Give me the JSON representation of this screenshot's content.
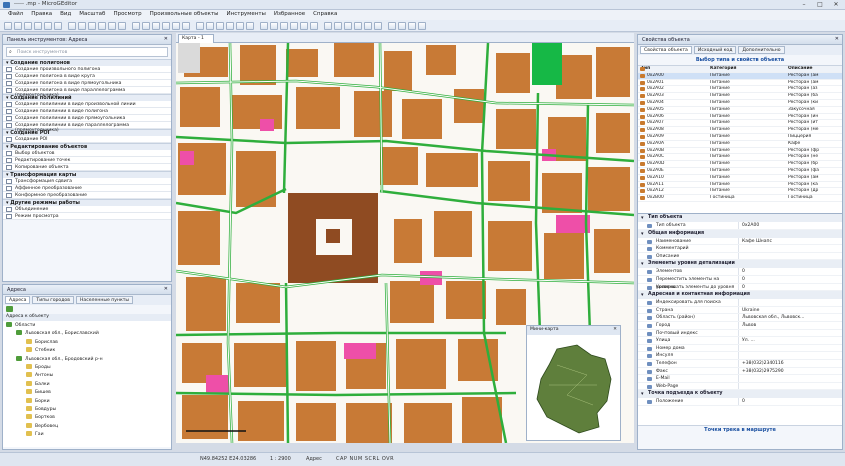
{
  "window": {
    "title": "----- .mp - MicroGEditor"
  },
  "menu": [
    "Файл",
    "Правка",
    "Вид",
    "Масштаб",
    "Просмотр",
    "Произвольные объекты",
    "Инструменты",
    "Избранное",
    "Справка"
  ],
  "tools_panel": {
    "title": "Панель инструментов: Адреса",
    "search_placeholder": "Поиск инструментов",
    "groups": [
      {
        "label": "Создание полигонов",
        "items": [
          "Создание произвольного полигона",
          "Создание полигона в виде круга",
          "Создание полигона в виде прямоугольника",
          "Создание полигона в виде параллелограмма (прямоугольника)"
        ]
      },
      {
        "label": "Создание полилиний",
        "items": [
          "Создание полилинии в виде произвольной линии",
          "Создание полилинии в виде полигона",
          "Создание полилинии в виде прямоугольника",
          "Создание полилинии в виде параллелограмма (прямоугольника)"
        ]
      },
      {
        "label": "Создание POI",
        "items": [
          "Создание POI"
        ]
      },
      {
        "label": "Редактирование объектов",
        "items": [
          "Выбор объектов",
          "Редактирование точек",
          "Копирование объекта"
        ]
      },
      {
        "label": "Трансформация карты",
        "items": [
          "Трансформация сдвига",
          "Аффинное преобразование",
          "Конформное преобразование"
        ]
      },
      {
        "label": "Другие режимы работы",
        "items": [
          "Объединение",
          "Режим просмотра"
        ]
      }
    ]
  },
  "addr_panel": {
    "title": "Адреса",
    "tabs": [
      "Адреса",
      "Типы городов",
      "Населенные пункты"
    ],
    "subheader": "Адреса к объекту",
    "tree": [
      {
        "label": "Области",
        "level": 0
      },
      {
        "label": "Львовская обл., Бориславский",
        "level": 1
      },
      {
        "label": "Борислав",
        "level": 2
      },
      {
        "label": "Стебник",
        "level": 2
      },
      {
        "label": "Львовская обл., Бродовский р-н",
        "level": 1
      },
      {
        "label": "Броды",
        "level": 2
      },
      {
        "label": "Антоны",
        "level": 2
      },
      {
        "label": "Балки",
        "level": 2
      },
      {
        "label": "Бишев",
        "level": 2
      },
      {
        "label": "Борки",
        "level": 2
      },
      {
        "label": "Бовдуры",
        "level": 2
      },
      {
        "label": "Бортков",
        "level": 2
      },
      {
        "label": "Вербовец",
        "level": 2
      },
      {
        "label": "Гаи",
        "level": 2
      }
    ]
  },
  "map": {
    "tab_label": "Карта - 1",
    "minimap_title": "Мини-карта"
  },
  "props_panel": {
    "title": "Свойства объекта",
    "tabs": [
      "Свойства объекта",
      "Исходный код",
      "Дополнительно"
    ],
    "type_header": "Выбор типа и свойств объекта",
    "columns": [
      "Тип",
      "Категория",
      "Описание"
    ],
    "rows": [
      [
        "0x2A00",
        "Питание",
        "Ресторан (ам"
      ],
      [
        "0x2A01",
        "Питание",
        "Ресторан (ам"
      ],
      [
        "0x2A02",
        "Питание",
        "Ресторан (аз"
      ],
      [
        "0x2A03",
        "Питание",
        "Ресторан (ба"
      ],
      [
        "0x2A04",
        "Питание",
        "Ресторан (ки"
      ],
      [
        "0x2A05",
        "Питание",
        "Закусочная"
      ],
      [
        "0x2A06",
        "Питание",
        "Ресторан (ин"
      ],
      [
        "0x2A07",
        "Питание",
        "Ресторан (ит"
      ],
      [
        "0x2A08",
        "Питание",
        "Ресторан (ме"
      ],
      [
        "0x2A09",
        "Питание",
        "Пиццерия"
      ],
      [
        "0x2A0A",
        "Питание",
        "Кафе"
      ],
      [
        "0x2A0B",
        "Питание",
        "Ресторан (фр"
      ],
      [
        "0x2A0C",
        "Питание",
        "Ресторан (не"
      ],
      [
        "0x2A0D",
        "Питание",
        "Ресторан (бр"
      ],
      [
        "0x2A0E",
        "Питание",
        "Ресторан (фа"
      ],
      [
        "0x2A10",
        "Питание",
        "Ресторан (ам"
      ],
      [
        "0x2A11",
        "Питание",
        "Ресторан (ка"
      ],
      [
        "0x2A12",
        "Питание",
        "Ресторан (др"
      ],
      [
        "0x2B00",
        "Гостиница",
        "Гостиница"
      ]
    ],
    "sections": [
      {
        "label": "Тип объекта",
        "props": [
          [
            "Тип объекта",
            "0x2A00"
          ]
        ]
      },
      {
        "label": "Общая информация",
        "props": [
          [
            "Наименование",
            "Кафе Шнапс"
          ],
          [
            "Комментарий",
            ""
          ],
          [
            "Описание",
            ""
          ]
        ]
      },
      {
        "label": "Элементы уровня детализации",
        "props": [
          [
            "Элементов",
            "0"
          ],
          [
            "Переместить элементы на уровень",
            "0"
          ],
          [
            "Копировать элементы до уровня",
            "0"
          ]
        ]
      },
      {
        "label": "Адресная и контактная информация",
        "props": [
          [
            "Индексировать для поиска",
            ""
          ],
          [
            "Страна",
            "Ukraine"
          ],
          [
            "Область (район)",
            "Львовская обл., Львовск..."
          ],
          [
            "Город",
            "Львов"
          ],
          [
            "Почтовый индекс",
            ""
          ],
          [
            "Улица",
            "Ул. ..."
          ],
          [
            "Номер дома",
            ""
          ],
          [
            "Инсуля",
            ""
          ],
          [
            "Телефон",
            "+38(032)2340116"
          ],
          [
            "Факс",
            "+38(032)2975290"
          ],
          [
            "E-Mail",
            ""
          ],
          [
            "Web-Page",
            ""
          ]
        ]
      },
      {
        "label": "Точка подъезда к объекту",
        "props": [
          [
            "Положение",
            "0"
          ]
        ]
      }
    ],
    "footer_link": "Точки трека в маршруте"
  },
  "status": {
    "coords": "N49.84252 E24.03286",
    "scale": "1 : 2900",
    "mode": "Адрес",
    "flags": [
      "CAP",
      "NUM",
      "SCRL",
      "OVR"
    ]
  },
  "colors": {
    "building": "#c87a36",
    "road": "#2fae3c",
    "poi_pink": "#ee4fa8",
    "park": "#16b846"
  }
}
